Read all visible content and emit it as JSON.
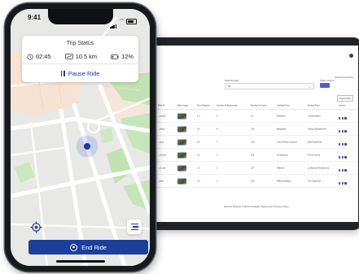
{
  "phone": {
    "status_time": "9:41",
    "trip_status": {
      "title": "Trip Status",
      "time": "02:45",
      "distance": "10.5 km",
      "battery": "12%",
      "pause_label": "Pause Ride"
    },
    "end_ride_label": "End Ride",
    "accent_color": "#1b3f9b"
  },
  "laptop": {
    "filter_label": "Date Rentals",
    "filter_value": "All",
    "status_label": "Status Filters",
    "top_links": "Dashboard  Rides",
    "export_label": "Export Data",
    "table": {
      "headers": [
        "Ride Id",
        "Bike Image",
        "Time Elapsed",
        "Number of Bookmarks",
        "Number of Users",
        "Starting Point",
        "Ending Point",
        "Actions"
      ],
      "rows": [
        {
          "id": "...ccbna",
          "time": "1.5",
          "bookmarks": "4",
          "users": "10",
          "start": "Rinkview",
          "end": "Central Metro"
        },
        {
          "id": "...rking",
          "time": "1.5",
          "bookmarks": "8",
          "users": "120",
          "start": "Beachline",
          "end": "Skybay Residences"
        },
        {
          "id": "...urbs",
          "time": "1.5",
          "bookmarks": "7",
          "users": "150",
          "start": "Grand Plaza Junction",
          "end": "Mall Road End"
        },
        {
          "id": "...nceasy",
          "time": "1.5",
          "bookmarks": "2",
          "users": "105",
          "start": "Forestacres",
          "end": "Tennis Arena"
        },
        {
          "id": "...et Loft",
          "time": "1.5",
          "bookmarks": "2",
          "users": "107",
          "start": "Hillcrest",
          "end": "Lo Bambo Residences"
        },
        {
          "id": "...ekin",
          "time": "1.5",
          "bookmarks": "2",
          "users": "109",
          "start": "Willows Bridge",
          "end": "The Gardenia"
        }
      ]
    },
    "footer": "Electric Wheelz ® 2024 All Rights Reserved | Privacy Policy"
  }
}
